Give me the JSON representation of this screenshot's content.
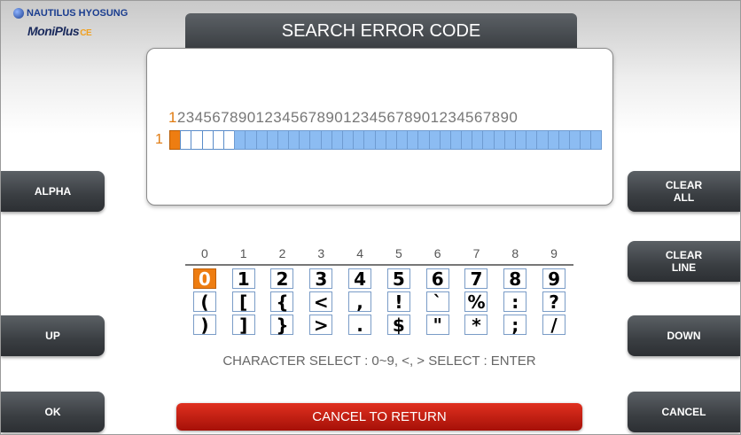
{
  "logo": {
    "brand": "NAUTILUS HYOSUNG",
    "product": "MoniPlus",
    "product_suffix": "CE"
  },
  "title": "SEARCH ERROR CODE",
  "editor": {
    "ruler_first": "1",
    "ruler_rest": "234567890123456789012345678901234567890",
    "row_number": "1",
    "cursor_position": 1,
    "total_cells": 40,
    "filled_from": 7
  },
  "left_buttons": {
    "alpha": "ALPHA",
    "up": "UP",
    "ok": "OK"
  },
  "right_buttons": {
    "clear_all_1": "CLEAR",
    "clear_all_2": "ALL",
    "clear_line_1": "CLEAR",
    "clear_line_2": "LINE",
    "down": "DOWN",
    "cancel": "CANCEL"
  },
  "keyboard": {
    "columns": [
      "0",
      "1",
      "2",
      "3",
      "4",
      "5",
      "6",
      "7",
      "8",
      "9"
    ],
    "rows": [
      [
        "0",
        "1",
        "2",
        "3",
        "4",
        "5",
        "6",
        "7",
        "8",
        "9"
      ],
      [
        "(",
        "[",
        "{",
        "<",
        ",",
        "!",
        "`",
        "%",
        ":",
        "?"
      ],
      [
        ")",
        "]",
        "}",
        ">",
        ".",
        "$",
        "\"",
        "*",
        ";",
        "/"
      ]
    ],
    "selected": "0"
  },
  "hint": "CHARACTER SELECT : 0~9, <, >  SELECT : ENTER",
  "cancel_bar": "CANCEL TO RETURN",
  "colors": {
    "accent": "#ee7d11",
    "fill": "#8cbcf2",
    "cancel": "#c41a0d",
    "button": "#3a3e42"
  }
}
